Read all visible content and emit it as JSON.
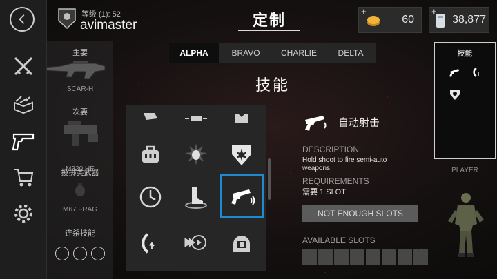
{
  "header": {
    "rank_label": "等级 (1): 52",
    "username": "avimaster",
    "title": "定制",
    "currencies": [
      {
        "plus": "+",
        "value": "60",
        "icon": "gold-coins-icon"
      },
      {
        "plus": "+",
        "value": "38,877",
        "icon": "credits-icon"
      }
    ]
  },
  "nav": {
    "items": [
      "back-icon",
      "melee-swords-icon",
      "box-icon",
      "pistol-icon",
      "cart-icon",
      "gear-icon"
    ]
  },
  "loadout": {
    "primary_label": "主要",
    "primary_name": "SCAR-H",
    "secondary_label": "次要",
    "secondary_name": "M320 HE",
    "throwable_label": "投掷类武器",
    "throwable_name": "M67 FRAG",
    "killstreak_label": "连杀技能"
  },
  "tabs": [
    "ALPHA",
    "BRAVO",
    "CHARLIE",
    "DELTA"
  ],
  "active_tab": "ALPHA",
  "section_title": "技能",
  "skill_grid": {
    "rows": [
      [
        "fist-icon",
        "armor-plate-icon",
        "vest-icon"
      ],
      [
        "toolkit-icon",
        "grenade-blast-icon",
        "blast-shield-icon"
      ],
      [
        "clock-icon",
        "boot-icon",
        "semi-auto-pistol-icon"
      ],
      [
        "stance-icon",
        "target-dash-icon",
        "helmet-icon"
      ]
    ],
    "selected": "semi-auto-pistol-icon"
  },
  "detail": {
    "skill_name": "自动射击",
    "description_heading": "DESCRIPTION",
    "description_text": "Hold shoot to fire semi-auto weapons.",
    "requirements_heading": "REQUIREMENTS",
    "requirements_text": "需要 1 SLOT",
    "button_label": "NOT ENOUGH SLOTS",
    "available_heading": "AVAILABLE SLOTS"
  },
  "right_panel": {
    "skills_title": "技能",
    "player_label": "PLAYER"
  },
  "colors": {
    "accent": "#1e8ad0",
    "gold": "#f2b33a"
  }
}
